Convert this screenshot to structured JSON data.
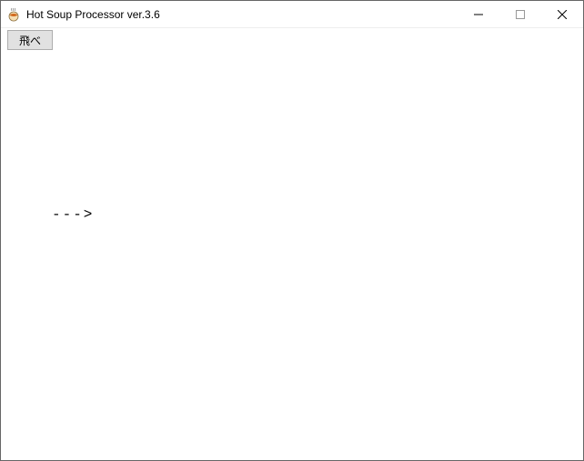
{
  "window": {
    "title": "Hot Soup Processor ver.3.6"
  },
  "toolbar": {
    "button_label": "飛べ"
  },
  "content": {
    "arrow": "--->"
  }
}
